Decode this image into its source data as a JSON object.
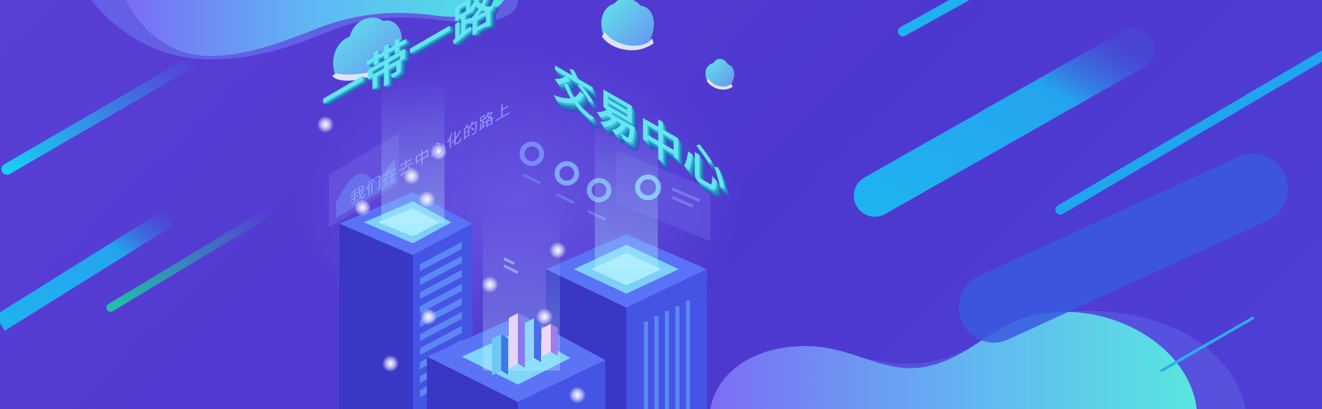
{
  "banner": {
    "title_part1": "一带一路",
    "title_part2": "交易中心",
    "subtitle": "我们在去中心化的路上"
  },
  "colors": {
    "background": "#4e3ad2",
    "accent_cyan": "#5fe8e6",
    "accent_blue": "#1fb2f0",
    "building": "#3a3fd0"
  }
}
